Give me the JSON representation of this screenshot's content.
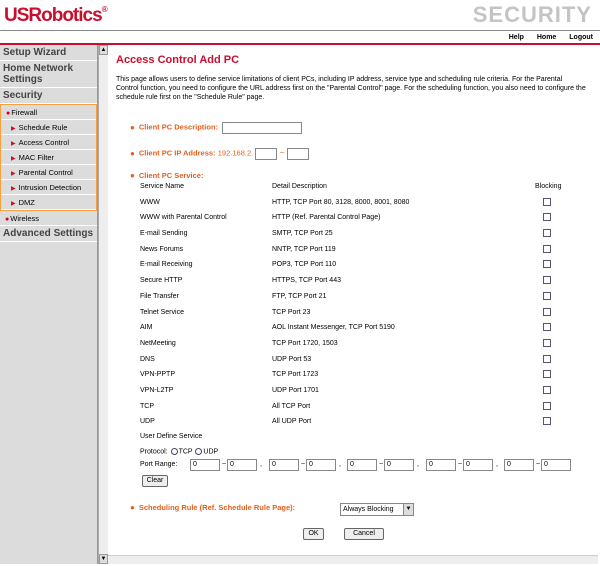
{
  "header": {
    "logo": "USRobotics",
    "section": "SECURITY"
  },
  "toplinks": [
    "Help",
    "Home",
    "Logout"
  ],
  "sidebar": {
    "setup_wizard": "Setup Wizard",
    "home_network": "Home Network Settings",
    "security": "Security",
    "firewall": "Firewall",
    "firewall_items": [
      "Schedule Rule",
      "Access Control",
      "MAC Filter",
      "Parental Control",
      "Intrusion Detection",
      "DMZ"
    ],
    "wireless": "Wireless",
    "advanced": "Advanced Settings"
  },
  "main": {
    "title": "Access Control Add PC",
    "intro": "This page allows users to define service limitations of client PCs, including IP address, service type and scheduling rule criteria. For the Parental Control function, you need to configure the URL address first on the \"Parental Control\" page. For the scheduling function, you also need to configure the schedule rule first on the \"Schedule Rule\" page.",
    "desc_label": "Client PC Description:",
    "desc_value": "",
    "ip_label": "Client PC IP Address:",
    "ip_prefix": "192.168.2.",
    "ip_start": "",
    "ip_tilde": "~",
    "ip_end": "",
    "service_label": "Client PC Service:",
    "col_service": "Service Name",
    "col_detail": "Detail Description",
    "col_blocking": "Blocking",
    "services": [
      {
        "name": "WWW",
        "detail": "HTTP, TCP Port 80, 3128, 8000, 8001, 8080"
      },
      {
        "name": "WWW with Parental Control",
        "detail": "HTTP (Ref. Parental Control Page)"
      },
      {
        "name": "E-mail Sending",
        "detail": "SMTP, TCP Port 25"
      },
      {
        "name": "News Forums",
        "detail": "NNTP, TCP Port 119"
      },
      {
        "name": "E-mail Receiving",
        "detail": "POP3, TCP Port 110"
      },
      {
        "name": "Secure HTTP",
        "detail": "HTTPS, TCP Port 443"
      },
      {
        "name": "File Transfer",
        "detail": "FTP, TCP Port 21"
      },
      {
        "name": "Telnet Service",
        "detail": "TCP Port 23"
      },
      {
        "name": "AIM",
        "detail": "AOL Instant Messenger, TCP Port 5190"
      },
      {
        "name": "NetMeeting",
        "detail": "TCP Port 1720, 1503"
      },
      {
        "name": "DNS",
        "detail": "UDP Port 53"
      },
      {
        "name": "VPN-PPTP",
        "detail": "TCP Port 1723"
      },
      {
        "name": "VPN-L2TP",
        "detail": "UDP Port 1701"
      },
      {
        "name": "TCP",
        "detail": "All TCP Port"
      },
      {
        "name": "UDP",
        "detail": "All UDP Port"
      }
    ],
    "user_define": "User Define Service",
    "protocol_label": "Protocol:",
    "tcp_label": "TCP",
    "udp_label": "UDP",
    "port_range_label": "Port Range:",
    "port_values": [
      "0",
      "0",
      "0",
      "0",
      "0",
      "0",
      "0",
      "0",
      "0",
      "0"
    ],
    "comma": ",",
    "tilde": "~",
    "clear_button": "Clear",
    "schedule_label": "Scheduling Rule (Ref. Schedule Rule Page):",
    "schedule_value": "Always Blocking",
    "ok_button": "OK",
    "cancel_button": "Cancel"
  }
}
